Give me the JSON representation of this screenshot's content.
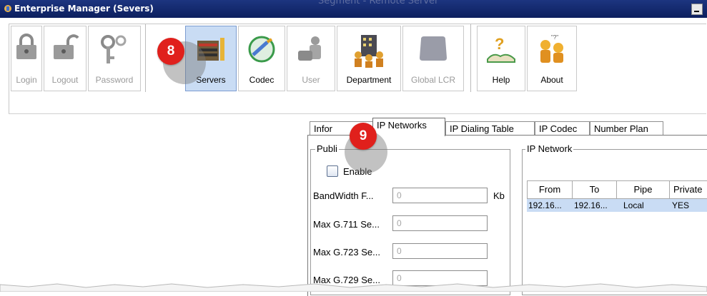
{
  "window": {
    "title": "Enterprise Manager  (Severs)",
    "ghost_title": "Segment - Remote Server"
  },
  "toolbar": {
    "buttons": [
      {
        "label": "Login",
        "icon": "lock-icon",
        "state": "disabled"
      },
      {
        "label": "Logout",
        "icon": "unlock-icon",
        "state": "disabled"
      },
      {
        "label": "Password",
        "icon": "key-icon",
        "state": "disabled"
      },
      {
        "label": "Servers",
        "icon": "server-icon",
        "state": "active"
      },
      {
        "label": "Codec",
        "icon": "codec-icon",
        "state": "enabled"
      },
      {
        "label": "User",
        "icon": "user-phone-icon",
        "state": "disabled"
      },
      {
        "label": "Department",
        "icon": "department-icon",
        "state": "enabled"
      },
      {
        "label": "Global LCR",
        "icon": "globe-icon",
        "state": "disabled"
      },
      {
        "label": "Help",
        "icon": "help-icon",
        "state": "enabled"
      },
      {
        "label": "About",
        "icon": "about-icon",
        "state": "enabled"
      }
    ]
  },
  "markers": {
    "m8": "8",
    "m9": "9"
  },
  "tabs": [
    {
      "label": "Infor",
      "active": false
    },
    {
      "label": "IP Networks",
      "active": true
    },
    {
      "label": "IP Dialing Table",
      "active": false
    },
    {
      "label": "IP Codec",
      "active": false
    },
    {
      "label": "Number Plan",
      "active": false
    }
  ],
  "public_group": {
    "title": "Publi",
    "enable_label": "Enable",
    "enable_checked": false,
    "fields": [
      {
        "label": "BandWidth F...",
        "value": "0",
        "unit": "Kb"
      },
      {
        "label": "Max G.711 Se...",
        "value": "0"
      },
      {
        "label": "Max G.723 Se...",
        "value": "0"
      },
      {
        "label": "Max G.729 Se...",
        "value": "0"
      }
    ]
  },
  "ip_network": {
    "title": "IP Network",
    "columns": [
      "From",
      "To",
      "Pipe",
      "Private"
    ],
    "rows": [
      [
        "192.16...",
        "192.16...",
        "Local",
        "YES"
      ]
    ]
  },
  "colors": {
    "titlebar": "#1d3580",
    "selection": "#c9dcf4",
    "marker": "#e0201c"
  }
}
